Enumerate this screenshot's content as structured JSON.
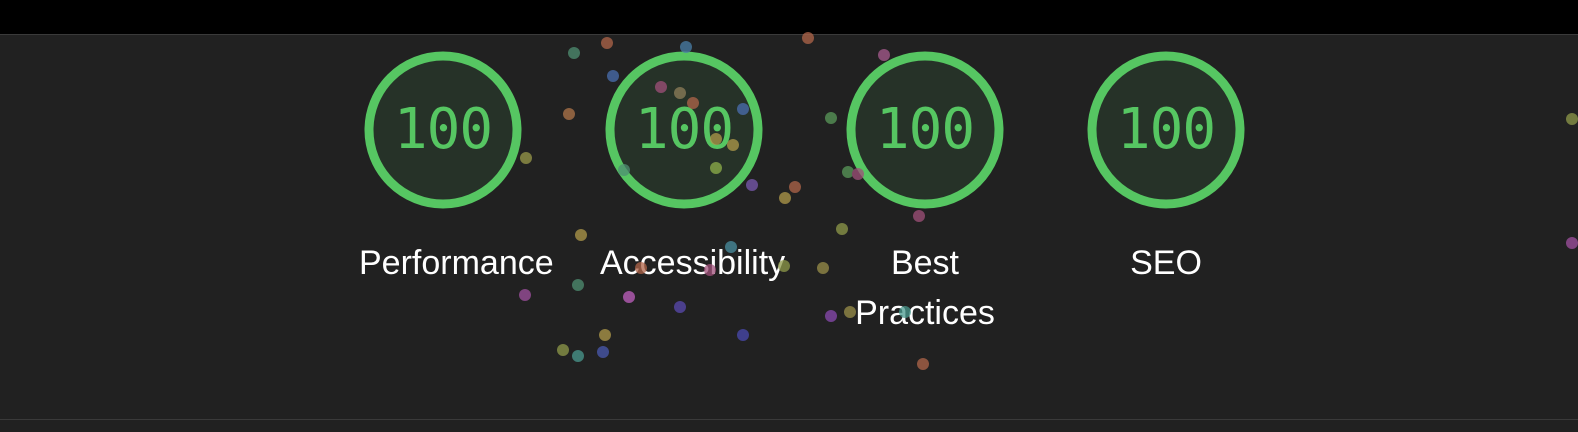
{
  "colors": {
    "pass": "#56c662",
    "pass_fill": "#263228",
    "panel_bg": "#212121",
    "label_text": "#ffffff"
  },
  "gauges": [
    {
      "score": "100",
      "label": "Performance"
    },
    {
      "score": "100",
      "label": "Accessibility"
    },
    {
      "score": "100",
      "label": "Best Practices"
    },
    {
      "score": "100",
      "label": "SEO"
    }
  ]
}
